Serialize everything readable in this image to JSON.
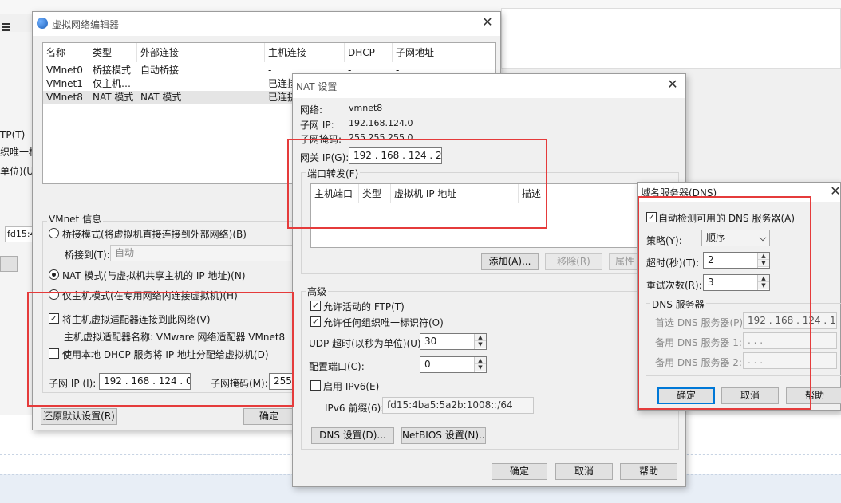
{
  "vne": {
    "title": "虚拟网络编辑器",
    "columns": [
      "名称",
      "类型",
      "外部连接",
      "主机连接",
      "DHCP",
      "子网地址"
    ],
    "rows": [
      [
        "VMnet0",
        "桥接模式",
        "自动桥接",
        "-",
        "-",
        "-"
      ],
      [
        "VMnet1",
        "仅主机…",
        "-",
        "已连接",
        "",
        ""
      ],
      [
        "VMnet8",
        "NAT 模式",
        "NAT 模式",
        "已连接",
        "",
        ""
      ]
    ],
    "info_label": "VMnet 信息",
    "bridge_radio": "桥接模式(将虚拟机直接连接到外部网络)(B)",
    "bridge_to_label": "桥接到(T):",
    "bridge_to_value": "自动",
    "nat_radio": "NAT 模式(与虚拟机共享主机的 IP 地址)(N)",
    "hostonly_radio": "仅主机模式(在专用网络内连接虚拟机)(H)",
    "connect_adapter": "将主机虚拟适配器连接到此网络(V)",
    "adapter_name": "主机虚拟适配器名称: VMware 网络适配器 VMnet8",
    "use_dhcp": "使用本地 DHCP 服务将 IP 地址分配给虚拟机(D)",
    "subnet_ip_label": "子网 IP (I):",
    "subnet_ip_value": "192 . 168 . 124 . 0",
    "subnet_mask_label": "子网掩码(M):",
    "subnet_mask_value": "255",
    "restore_btn": "还原默认设置(R)",
    "ok_btn": "确定"
  },
  "bg": {
    "ftp": "TP(T)",
    "unique": "织唯一标",
    "unit": "单位)(U)",
    "ipv6": "fd15:4"
  },
  "nat": {
    "title": "NAT 设置",
    "network_label": "网络:",
    "network_value": "vmnet8",
    "subnet_ip_label": "子网 IP:",
    "subnet_ip_value": "192.168.124.0",
    "subnet_mask_label": "子网掩码:",
    "subnet_mask_value": "255.255.255.0",
    "gateway_label": "网关 IP(G):",
    "gateway_value": "192 . 168 . 124 . 2",
    "port_forward_label": "端口转发(F)",
    "pf_columns": [
      "主机端口",
      "类型",
      "虚拟机 IP 地址",
      "描述"
    ],
    "add_btn": "添加(A)...",
    "remove_btn": "移除(R)",
    "props_btn": "属性",
    "advanced_label": "高级",
    "allow_ftp": "允许活动的 FTP(T)",
    "allow_oui": "允许任何组织唯一标识符(O)",
    "udp_timeout_label": "UDP 超时(以秒为单位)(U):",
    "udp_timeout_value": "30",
    "config_port_label": "配置端口(C):",
    "config_port_value": "0",
    "enable_ipv6": "启用 IPv6(E)",
    "ipv6_prefix_label": "IPv6 前缀(6):",
    "ipv6_prefix_value": "fd15:4ba5:5a2b:1008::/64",
    "dns_btn": "DNS 设置(D)...",
    "netbios_btn": "NetBIOS 设置(N)...",
    "ok_btn": "确定",
    "cancel_btn": "取消",
    "help_btn": "帮助"
  },
  "dns": {
    "title": "域名服务器(DNS)",
    "auto_detect": "自动检测可用的 DNS 服务器(A)",
    "policy_label": "策略(Y):",
    "policy_value": "顺序",
    "timeout_label": "超时(秒)(T):",
    "timeout_value": "2",
    "retries_label": "重试次数(R):",
    "retries_value": "3",
    "servers_group": "DNS 服务器",
    "preferred_label": "首选 DNS 服务器(P):",
    "preferred_value": "192 . 168 . 124 . 1",
    "alt1_label": "备用 DNS 服务器 1:",
    "alt1_value": ".   .   .",
    "alt2_label": "备用 DNS 服务器 2:",
    "alt2_value": ".   .   .",
    "ok_btn": "确定",
    "cancel_btn": "取消",
    "help_btn": "帮助"
  },
  "colors": {
    "highlight_border": "#e53b3b",
    "default_btn_border": "#0078d7"
  }
}
